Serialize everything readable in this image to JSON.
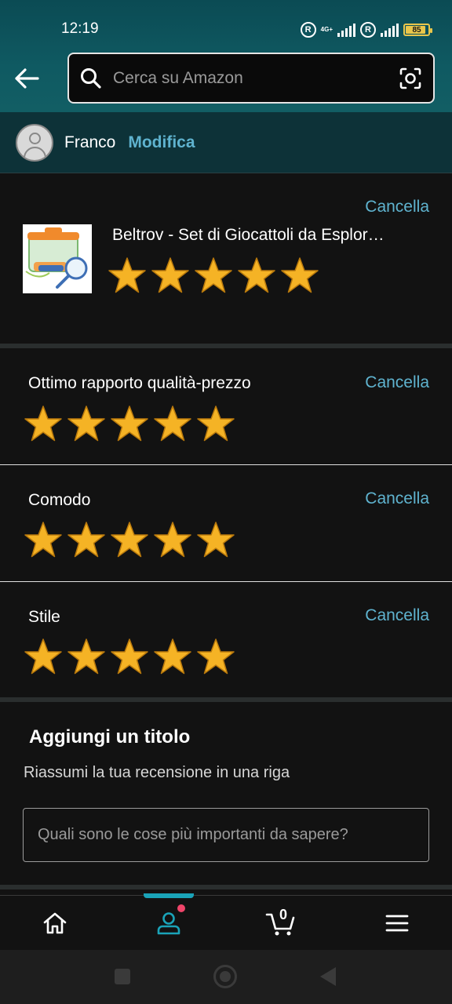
{
  "status_bar": {
    "time": "12:19",
    "network": "4G+",
    "battery": "85",
    "sim_badge": "R"
  },
  "search": {
    "placeholder": "Cerca su Amazon"
  },
  "profile": {
    "name": "Franco",
    "edit_label": "Modifica"
  },
  "product_review": {
    "title": "Beltrov - Set di Giocattoli da Esplor…",
    "cancel_label": "Cancella",
    "rating": 5
  },
  "attribute_ratings": [
    {
      "label": "Ottimo rapporto qualità-prezzo",
      "cancel_label": "Cancella",
      "rating": 5
    },
    {
      "label": "Comodo",
      "cancel_label": "Cancella",
      "rating": 5
    },
    {
      "label": "Stile",
      "cancel_label": "Cancella",
      "rating": 5
    }
  ],
  "title_section": {
    "heading": "Aggiungi un titolo",
    "subheading": "Riassumi la tua recensione in una riga",
    "input_placeholder": "Quali sono le cose più importanti da sapere?",
    "input_value": ""
  },
  "bottom_nav": {
    "cart_count": "0",
    "items": [
      "home-icon",
      "account-icon",
      "cart-icon",
      "menu-icon"
    ],
    "active": "account-icon"
  },
  "colors": {
    "accent_link": "#5fb3cf",
    "star": "#f5b325",
    "header_teal": "#0f5a62",
    "nav_indicator": "#1aa3b8",
    "notification": "#f0456a"
  }
}
